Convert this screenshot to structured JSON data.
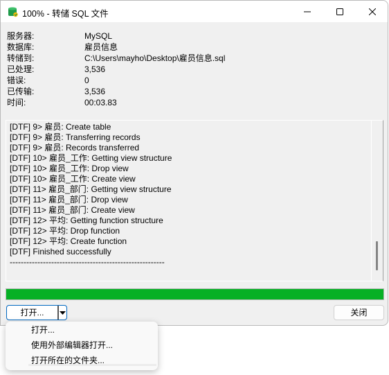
{
  "window": {
    "title": "100% - 转储 SQL 文件",
    "app_icon": "database-export-icon",
    "controls": [
      "minimize-icon",
      "maximize-icon",
      "close-icon"
    ]
  },
  "info": [
    {
      "label": "服务器:",
      "value": "MySQL"
    },
    {
      "label": "数据库:",
      "value": "雇员信息"
    },
    {
      "label": "转储到:",
      "value": "C:\\Users\\mayho\\Desktop\\雇员信息.sql"
    },
    {
      "label": "已处理:",
      "value": "3,536"
    },
    {
      "label": "错误:",
      "value": "0"
    },
    {
      "label": "已传输:",
      "value": "3,536"
    },
    {
      "label": "时间:",
      "value": "00:03.83"
    }
  ],
  "log": [
    "[DTF] 9> 雇员: Create table",
    "[DTF] 9> 雇员: Transferring records",
    "[DTF] 9> 雇员: Records transferred",
    "[DTF] 10> 雇员_工作: Getting view structure",
    "[DTF] 10> 雇员_工作: Drop view",
    "[DTF] 10> 雇员_工作: Create view",
    "[DTF] 11> 雇员_部门: Getting view structure",
    "[DTF] 11> 雇员_部门: Drop view",
    "[DTF] 11> 雇员_部门: Create view",
    "[DTF] 12> 平均: Getting function structure",
    "[DTF] 12> 平均: Drop function",
    "[DTF] 12> 平均: Create function",
    "[DTF] Finished successfully",
    "--------------------------------------------------------"
  ],
  "progress": {
    "percent": 100,
    "color": "#06b025"
  },
  "buttons": {
    "open": "打开...",
    "close": "关闭"
  },
  "menu": [
    "打开...",
    "使用外部编辑器打开...",
    "打开所在的文件夹..."
  ]
}
